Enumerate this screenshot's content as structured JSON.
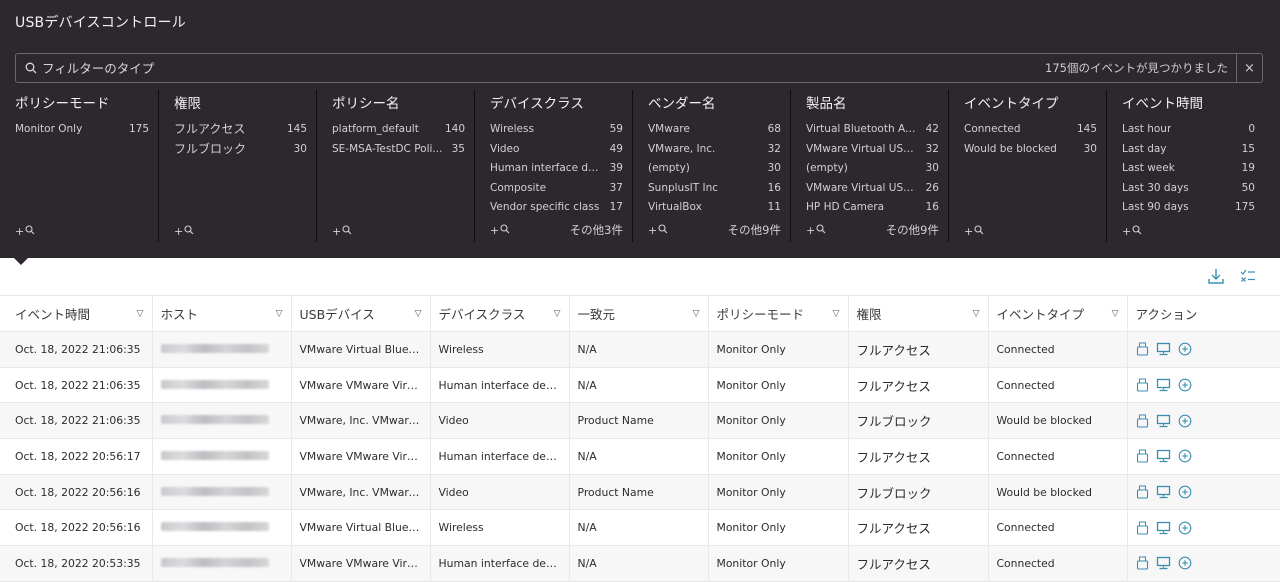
{
  "app": {
    "title": "USBデバイスコントロール"
  },
  "search": {
    "placeholder": "フィルターのタイプ",
    "value": "",
    "result_count": "175個のイベントが見つかりました",
    "clear_label": "×"
  },
  "facets": [
    {
      "title": "ポリシーモード",
      "items": [
        {
          "label": "Monitor Only",
          "count": "175"
        }
      ],
      "more": ""
    },
    {
      "title": "権限",
      "items": [
        {
          "label": "フルアクセス",
          "count": "145"
        },
        {
          "label": "フルブロック",
          "count": "30"
        }
      ],
      "more": ""
    },
    {
      "title": "ポリシー名",
      "items": [
        {
          "label": "platform_default",
          "count": "140"
        },
        {
          "label": "SE-MSA-TestDC Poli...",
          "count": "35"
        }
      ],
      "more": ""
    },
    {
      "title": "デバイスクラス",
      "items": [
        {
          "label": "Wireless",
          "count": "59"
        },
        {
          "label": "Video",
          "count": "49"
        },
        {
          "label": "Human interface dev...",
          "count": "39"
        },
        {
          "label": "Composite",
          "count": "37"
        },
        {
          "label": "Vendor specific class",
          "count": "17"
        }
      ],
      "more": "その他3件"
    },
    {
      "title": "ベンダー名",
      "items": [
        {
          "label": "VMware",
          "count": "68"
        },
        {
          "label": "VMware, Inc.",
          "count": "32"
        },
        {
          "label": "(empty)",
          "count": "30"
        },
        {
          "label": "SunplusIT Inc",
          "count": "16"
        },
        {
          "label": "VirtualBox",
          "count": "11"
        }
      ],
      "more": "その他9件"
    },
    {
      "title": "製品名",
      "items": [
        {
          "label": "Virtual Bluetooth Ad...",
          "count": "42"
        },
        {
          "label": "VMware Virtual USB ...",
          "count": "32"
        },
        {
          "label": "(empty)",
          "count": "30"
        },
        {
          "label": "VMware Virtual USB ...",
          "count": "26"
        },
        {
          "label": "HP HD Camera",
          "count": "16"
        }
      ],
      "more": "その他9件"
    },
    {
      "title": "イベントタイプ",
      "items": [
        {
          "label": "Connected",
          "count": "145"
        },
        {
          "label": "Would be blocked",
          "count": "30"
        }
      ],
      "more": ""
    },
    {
      "title": "イベント時間",
      "items": [
        {
          "label": "Last hour",
          "count": "0"
        },
        {
          "label": "Last day",
          "count": "15"
        },
        {
          "label": "Last week",
          "count": "19"
        },
        {
          "label": "Last 30 days",
          "count": "50"
        },
        {
          "label": "Last 90 days",
          "count": "175"
        }
      ],
      "more": ""
    }
  ],
  "facet_add_label": "+",
  "table": {
    "columns": [
      "イベント時間",
      "ホスト",
      "USBデバイス",
      "デバイスクラス",
      "一致元",
      "ポリシーモード",
      "権限",
      "イベントタイプ",
      "アクション"
    ],
    "rows": [
      {
        "time": "Oct. 18, 2022 21:06:35",
        "device": "VMware Virtual Bluet...",
        "class": "Wireless",
        "match": "N/A",
        "mode": "Monitor Only",
        "perm": "フルアクセス",
        "event": "Connected"
      },
      {
        "time": "Oct. 18, 2022 21:06:35",
        "device": "VMware VMware Virtu...",
        "class": "Human interface devi...",
        "match": "N/A",
        "mode": "Monitor Only",
        "perm": "フルアクセス",
        "event": "Connected"
      },
      {
        "time": "Oct. 18, 2022 21:06:35",
        "device": "VMware, Inc. VMware ...",
        "class": "Video",
        "match": "Product Name",
        "mode": "Monitor Only",
        "perm": "フルブロック",
        "event": "Would be blocked"
      },
      {
        "time": "Oct. 18, 2022 20:56:17",
        "device": "VMware VMware Virtu...",
        "class": "Human interface devi...",
        "match": "N/A",
        "mode": "Monitor Only",
        "perm": "フルアクセス",
        "event": "Connected"
      },
      {
        "time": "Oct. 18, 2022 20:56:16",
        "device": "VMware, Inc. VMware ...",
        "class": "Video",
        "match": "Product Name",
        "mode": "Monitor Only",
        "perm": "フルブロック",
        "event": "Would be blocked"
      },
      {
        "time": "Oct. 18, 2022 20:56:16",
        "device": "VMware Virtual Bluet...",
        "class": "Wireless",
        "match": "N/A",
        "mode": "Monitor Only",
        "perm": "フルアクセス",
        "event": "Connected"
      },
      {
        "time": "Oct. 18, 2022 20:53:35",
        "device": "VMware VMware Virtu...",
        "class": "Human interface devi...",
        "match": "N/A",
        "mode": "Monitor Only",
        "perm": "フルアクセス",
        "event": "Connected"
      }
    ]
  },
  "icons": {
    "usb": "usb-device-icon",
    "computer": "computer-icon",
    "add": "add-circle-icon",
    "download": "download-icon",
    "columns": "column-chooser-icon",
    "search": "search-icon",
    "sort": "sort-icon"
  },
  "colors": {
    "panel_bg": "#2c282e",
    "accent": "#3a8fb0"
  }
}
